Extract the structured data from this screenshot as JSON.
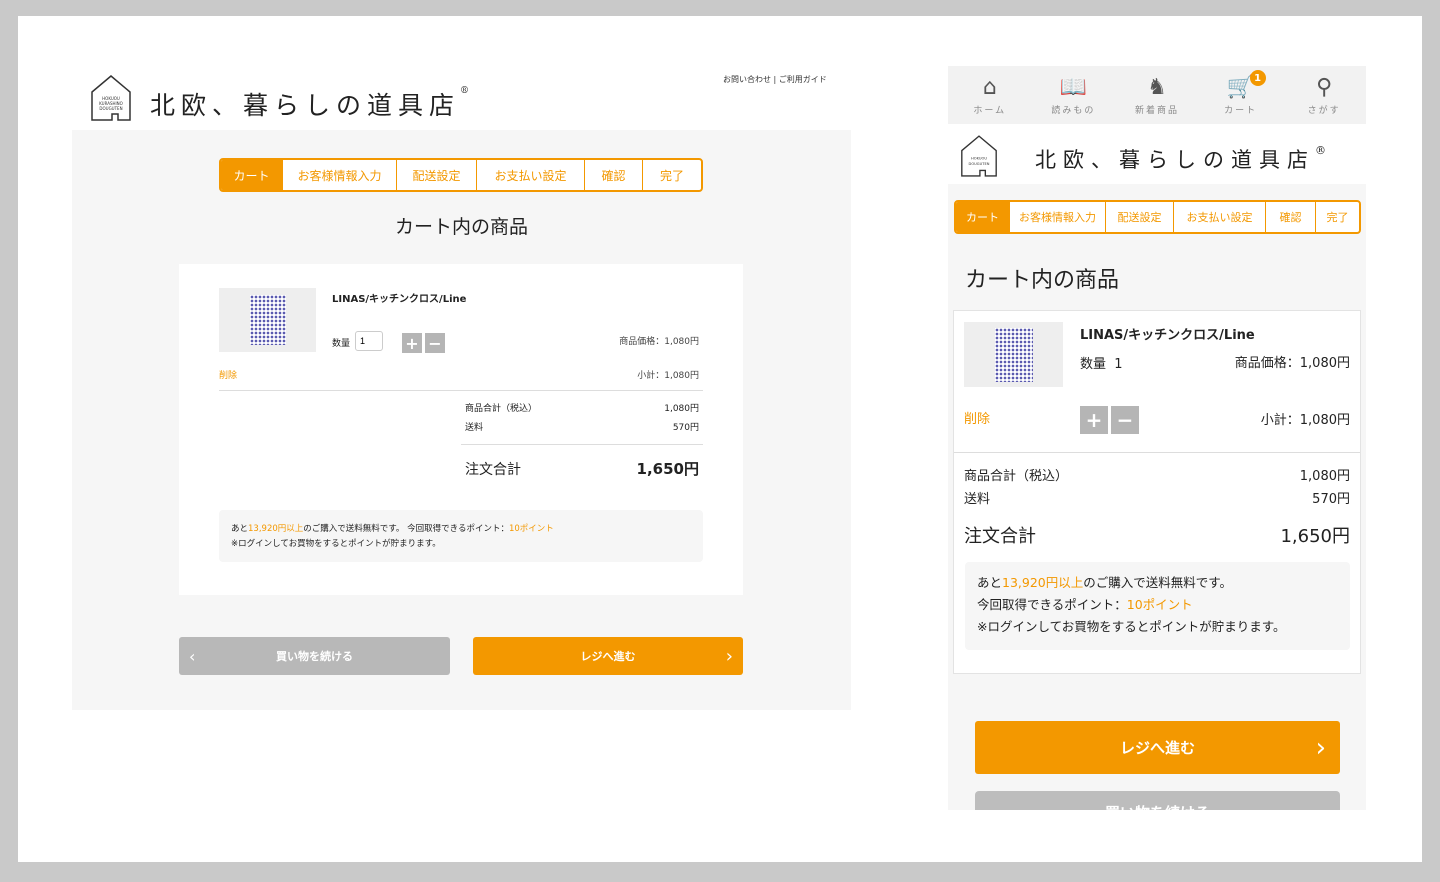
{
  "brand": {
    "name": "北欧、暮らしの道具店",
    "reg": "®",
    "logo_text": "HOKUOU KURASHINO DOUGUTEN"
  },
  "header_links": {
    "contact": "お問い合わせ",
    "sep": "|",
    "guide": "ご利用ガイド"
  },
  "steps": [
    "カート",
    "お客様情報入力",
    "配送設定",
    "お支払い設定",
    "確認",
    "完了"
  ],
  "page_title": "カート内の商品",
  "item": {
    "name": "LINAS/キッチンクロス/Line",
    "qty_label": "数量",
    "qty": "1",
    "price_label": "商品価格：",
    "price": "1,080円",
    "delete": "削除",
    "subtotal_label": "小計：",
    "subtotal": "1,080円",
    "plus": "+",
    "minus": "−"
  },
  "summary": {
    "goods_label": "商品合計（税込）",
    "goods": "1,080円",
    "shipping_label": "送料",
    "shipping": "570円",
    "total_label": "注文合計",
    "total": "1,650円"
  },
  "notice": {
    "pre": "あと",
    "amount": "13,920円以上",
    "post": "のご購入で送料無料です。",
    "points_label": "今回取得できるポイント：",
    "points": "10ポイント",
    "login": "※ログインしてお買物をするとポイントが貯まります。"
  },
  "buttons": {
    "continue": "買い物を続ける",
    "checkout": "レジへ進む"
  },
  "mobile_nav": [
    {
      "label": "ホーム",
      "icon": "home-icon"
    },
    {
      "label": "読みもの",
      "icon": "book-icon"
    },
    {
      "label": "新着商品",
      "icon": "horse-icon"
    },
    {
      "label": "カート",
      "icon": "cart-icon",
      "badge": "1"
    },
    {
      "label": "さがす",
      "icon": "search-icon"
    }
  ],
  "colors": {
    "accent": "#f39800",
    "bg": "#f6f6f6",
    "button_gray": "#b8b8b8"
  }
}
